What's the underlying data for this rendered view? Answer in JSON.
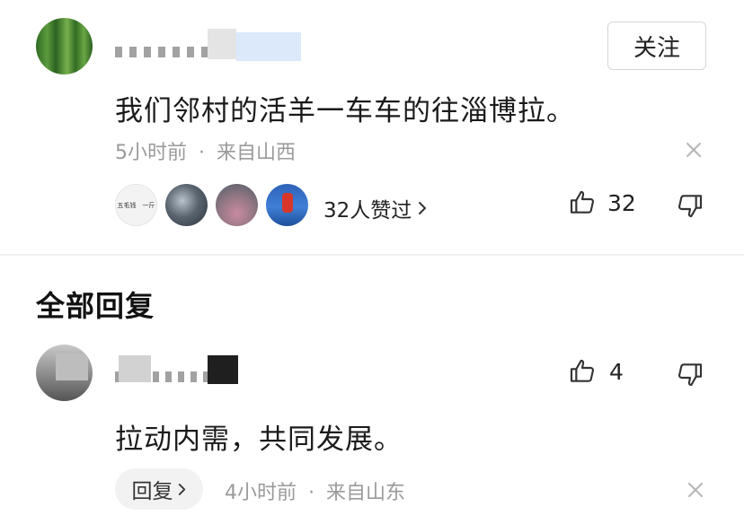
{
  "main_comment": {
    "follow_label": "关注",
    "text": "我们邻村的活羊一车车的往淄博拉。",
    "time": "5小时前",
    "location": "来自山西",
    "likers_text": "32人赞过",
    "liker1_text": "五毛钱　一斤",
    "like_count": "32"
  },
  "replies_section": {
    "title": "全部回复"
  },
  "reply": {
    "text": "拉动内需，共同发展。",
    "like_count": "4",
    "reply_label": "回复",
    "time": "4小时前",
    "location": "来自山东"
  },
  "meta_separator": "·",
  "colors": {
    "avatar_green": "#3f7a2c",
    "divider": "#f0f0f0",
    "muted_text": "#9a9a9a"
  }
}
